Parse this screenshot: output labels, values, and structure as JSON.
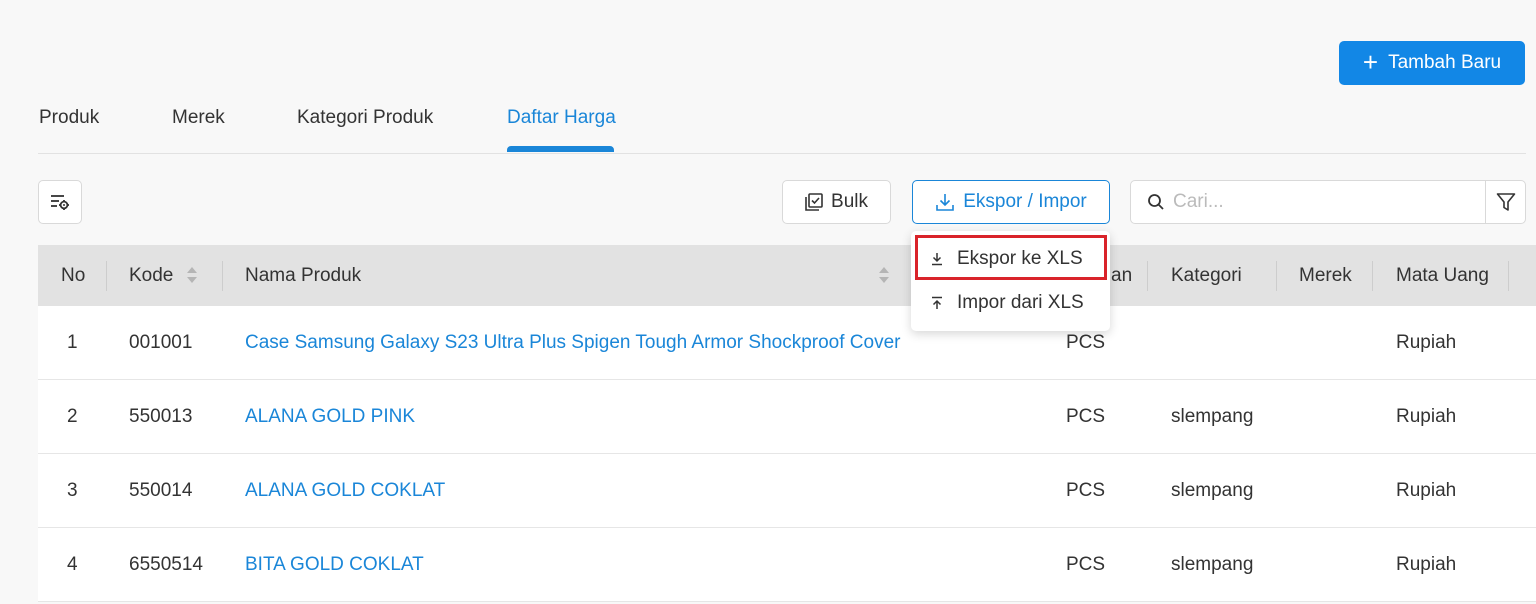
{
  "header": {
    "add_button_label": "Tambah Baru"
  },
  "tabs": [
    {
      "label": "Produk"
    },
    {
      "label": "Merek"
    },
    {
      "label": "Kategori Produk"
    },
    {
      "label": "Daftar Harga"
    }
  ],
  "toolbar": {
    "bulk_label": "Bulk",
    "export_import_label": "Ekspor / Impor",
    "search_placeholder": "Cari..."
  },
  "dropdown": {
    "items": [
      {
        "label": "Ekspor ke XLS"
      },
      {
        "label": "Impor dari XLS"
      }
    ]
  },
  "table": {
    "columns": {
      "no": "No",
      "kode": "Kode",
      "nama_produk": "Nama Produk",
      "satuan_partial": "an",
      "kategori": "Kategori",
      "merek": "Merek",
      "mata_uang": "Mata Uang"
    },
    "rows": [
      {
        "no": "1",
        "kode": "001001",
        "nama": "Case Samsung Galaxy S23 Ultra Plus Spigen Tough Armor Shockproof Cover",
        "satuan": "PCS",
        "kategori": "",
        "merek": "",
        "mata_uang": "Rupiah"
      },
      {
        "no": "2",
        "kode": "550013",
        "nama": "ALANA GOLD PINK",
        "satuan": "PCS",
        "kategori": "slempang",
        "merek": "",
        "mata_uang": "Rupiah"
      },
      {
        "no": "3",
        "kode": "550014",
        "nama": "ALANA GOLD COKLAT",
        "satuan": "PCS",
        "kategori": "slempang",
        "merek": "",
        "mata_uang": "Rupiah"
      },
      {
        "no": "4",
        "kode": "6550514",
        "nama": "BITA GOLD COKLAT",
        "satuan": "PCS",
        "kategori": "slempang",
        "merek": "",
        "mata_uang": "Rupiah"
      }
    ]
  },
  "colors": {
    "accent": "#1a86d8",
    "button_primary": "#1287e6",
    "header_bg": "#e2e2e2",
    "highlight": "#d9232a"
  }
}
